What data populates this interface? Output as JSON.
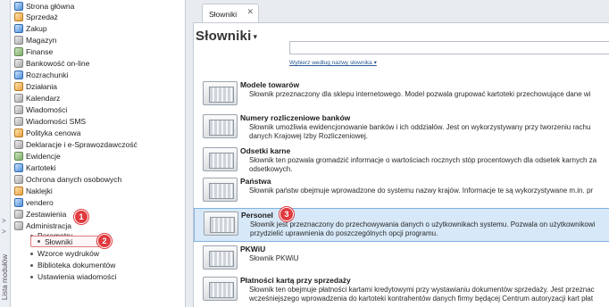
{
  "side_strip": {
    "label": "Lista modułów",
    "chevrons": [
      ">",
      ">"
    ]
  },
  "sidebar": {
    "items": [
      {
        "label": "Strona główna",
        "icon": "home-icon"
      },
      {
        "label": "Sprzedaż",
        "icon": "sales-icon"
      },
      {
        "label": "Zakup",
        "icon": "purchase-icon"
      },
      {
        "label": "Magazyn",
        "icon": "warehouse-icon"
      },
      {
        "label": "Finanse",
        "icon": "finance-icon"
      },
      {
        "label": "Bankowość on-line",
        "icon": "bank-icon"
      },
      {
        "label": "Rozrachunki",
        "icon": "settlements-icon"
      },
      {
        "label": "Działania",
        "icon": "actions-icon"
      },
      {
        "label": "Kalendarz",
        "icon": "calendar-icon"
      },
      {
        "label": "Wiadomości",
        "icon": "messages-icon"
      },
      {
        "label": "Wiadomości SMS",
        "icon": "sms-icon"
      },
      {
        "label": "Polityka cenowa",
        "icon": "pricing-icon"
      },
      {
        "label": "Deklaracje i e-Sprawozdawczość",
        "icon": "declarations-icon"
      },
      {
        "label": "Ewidencje",
        "icon": "records-icon"
      },
      {
        "label": "Kartoteki",
        "icon": "cards-icon"
      },
      {
        "label": "Ochrona danych osobowych",
        "icon": "shield-icon"
      },
      {
        "label": "Naklejki",
        "icon": "stickers-icon"
      },
      {
        "label": "vendero",
        "icon": "vendero-icon"
      },
      {
        "label": "Zestawienia",
        "icon": "reports-icon"
      },
      {
        "label": "Administracja",
        "icon": "admin-icon"
      }
    ],
    "admin_children": [
      {
        "label": "Parametry"
      },
      {
        "label": "Słowniki"
      },
      {
        "label": "Wzorce wydruków"
      },
      {
        "label": "Biblioteka dokumentów"
      },
      {
        "label": "Ustawienia wiadomości"
      }
    ],
    "badges": [
      "1",
      "2",
      "3"
    ]
  },
  "tab": {
    "label": "Słowniki",
    "close": "✕"
  },
  "main": {
    "title": "Słowniki",
    "title_caret": "▾",
    "search_placeholder": "",
    "filter_label": "Wybierz według nazwy słownika ▾",
    "rows": [
      {
        "name": "Modele towarów",
        "desc": "Słownik przeznaczony dla sklepu internetowego. Model pozwala grupować kartoteki przechowujące dane wi"
      },
      {
        "name": "Numery rozliczeniowe banków",
        "desc": "Słownik umożliwia ewidencjonowanie banków i ich oddziałów. Jest on wykorzystywany przy tworzeniu rachu danych Krajowej Izby Rozliczeniowej."
      },
      {
        "name": "Odsetki karne",
        "desc": "Słownik ten pozwala gromadzić informacje o wartościach rocznych stóp procentowych dla odsetek karnych za odsetkowych."
      },
      {
        "name": "Państwa",
        "desc": "Słownik państw obejmuje wprowadzone do systemu nazwy krajów. Informacje te są wykorzystywane m.in. pr"
      },
      {
        "name": "Personel",
        "desc": "Słownik jest przeznaczony do przechowywania danych o użytkownikach systemu. Pozwala on użytkownikowi przydzielić uprawnienia do poszczególnych opcji programu."
      },
      {
        "name": "PKWiU",
        "desc": "Słownik PKWiU"
      },
      {
        "name": "Płatności kartą przy sprzedaży",
        "desc": "Słownik ten obejmuje płatności kartami kredytowymi przy wystawianiu dokumentów sprzedaży. Jest przeznac wcześniejszego wprowadzenia do kartoteki kontrahentów danych firmy będącej Centrum autoryzacji kart płat"
      }
    ]
  }
}
